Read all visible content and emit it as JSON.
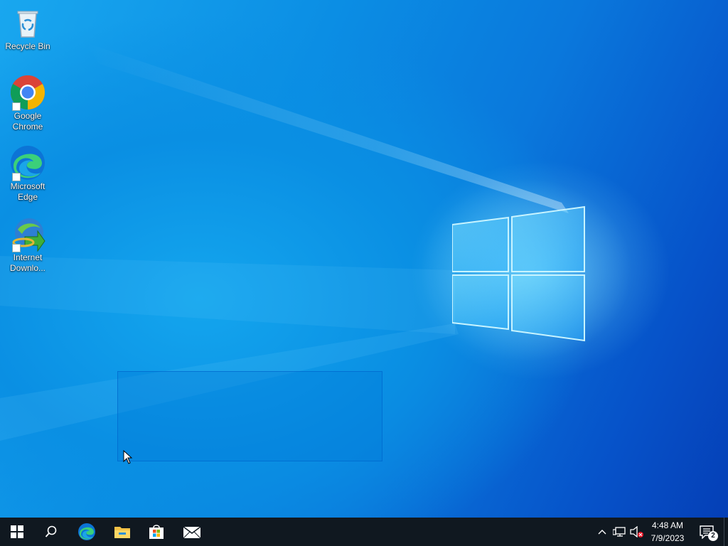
{
  "desktop": {
    "icons": [
      {
        "label": "Recycle Bin"
      },
      {
        "label": "Google\nChrome"
      },
      {
        "label": "Microsoft\nEdge"
      },
      {
        "label": "Internet\nDownlo..."
      }
    ]
  },
  "taskbar": {
    "items": [
      {
        "icon": "windows-start-icon"
      },
      {
        "icon": "search-icon"
      },
      {
        "icon": "edge-icon"
      },
      {
        "icon": "file-explorer-icon"
      },
      {
        "icon": "microsoft-store-icon"
      },
      {
        "icon": "mail-icon"
      }
    ],
    "tray": {
      "clock_time": "4:48 AM",
      "clock_date": "7/9/2023",
      "notification_count": "2"
    }
  },
  "colors": {
    "taskbar_bg": "#101820",
    "wallpaper_accent": "#0a78dc",
    "selection": "#0078d7"
  }
}
